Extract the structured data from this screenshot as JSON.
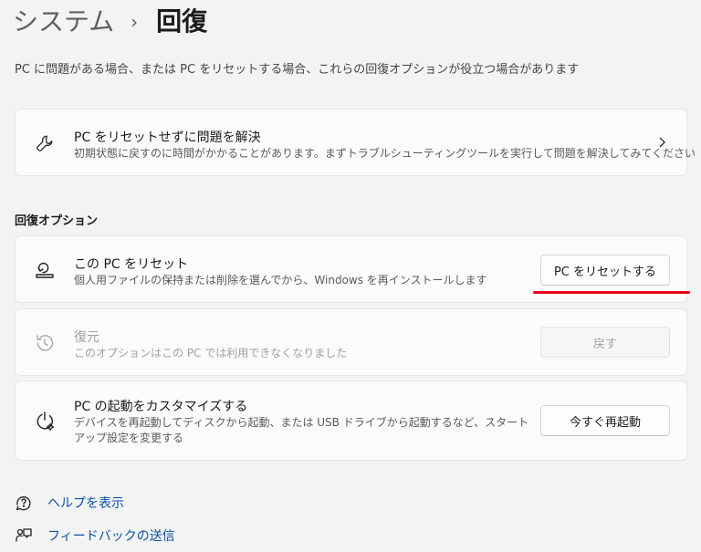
{
  "breadcrumb": {
    "parent": "システム",
    "separator": "›",
    "current": "回復"
  },
  "description": "PC に問題がある場合、または PC をリセットする場合、これらの回復オプションが役立つ場合があります",
  "troubleshoot": {
    "title": "PC をリセットせずに問題を解決",
    "subtitle": "初期状態に戻すのに時間がかかることがあります。まずトラブルシューティングツールを実行して問題を解決してみてください",
    "icon": "wrench-icon"
  },
  "section_label": "回復オプション",
  "options": {
    "reset": {
      "title": "この PC をリセット",
      "subtitle": "個人用ファイルの保持または削除を選んでから、Windows を再インストールします",
      "button": "PC をリセットする",
      "icon": "reset-pc-icon"
    },
    "goback": {
      "title": "復元",
      "subtitle": "このオプションはこの PC では利用できなくなりました",
      "button": "戻す",
      "icon": "history-icon"
    },
    "advanced": {
      "title": "PC の起動をカスタマイズする",
      "subtitle": "デバイスを再起動してディスクから起動、または USB ドライブから起動するなど、スタートアップ設定を変更する",
      "button": "今すぐ再起動",
      "icon": "advanced-startup-icon"
    }
  },
  "links": {
    "help": "ヘルプを表示",
    "feedback": "フィードバックの送信"
  },
  "colors": {
    "accent_link": "#0a4fa8",
    "highlight_underline": "#e8001c"
  }
}
